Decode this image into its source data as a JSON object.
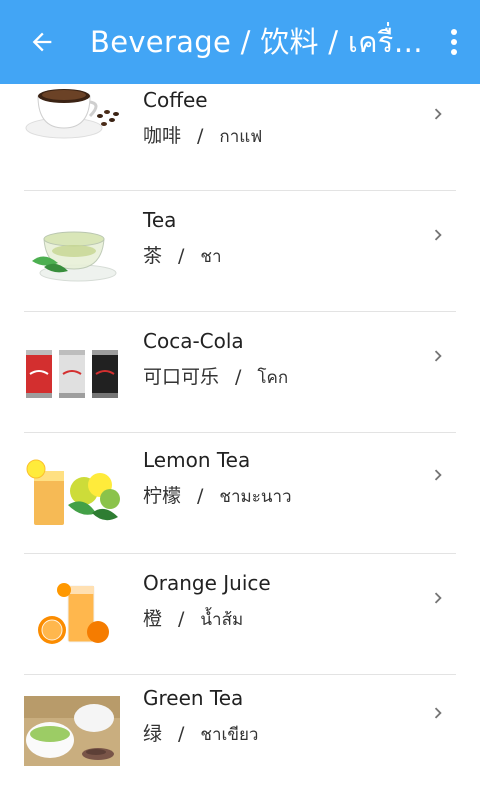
{
  "appbar": {
    "title": "Beverage / 饮料 / เครื่องดื่ม",
    "back_icon": "arrow-back-icon",
    "menu_icon": "more-vert-icon",
    "color": "#42A5F5"
  },
  "items": [
    {
      "name": "Coffee",
      "zh": "咖啡",
      "th": "กาแฟ",
      "image": "coffee-cup"
    },
    {
      "name": "Tea",
      "zh": "茶",
      "th": "ชา",
      "image": "glass-teacup"
    },
    {
      "name": "Coca-Cola",
      "zh": "可口可乐",
      "th": "โคก",
      "image": "cola-cans"
    },
    {
      "name": "Lemon Tea",
      "zh": "柠檬",
      "th": "ชามะนาว",
      "image": "lemon-tea-glass"
    },
    {
      "name": "Orange Juice",
      "zh": "橙",
      "th": "น้ำส้ม",
      "image": "orange-juice-glass"
    },
    {
      "name": "Green Tea",
      "zh": "绿",
      "th": "ชาเขียว",
      "image": "green-tea-cup"
    }
  ],
  "separator": "/"
}
